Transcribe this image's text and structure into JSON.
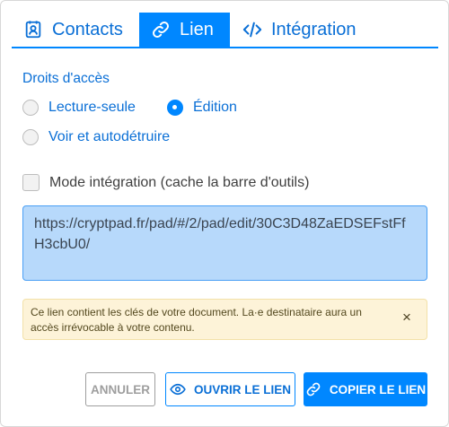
{
  "tabs": [
    {
      "label": "Contacts",
      "icon": "contact-book-icon",
      "active": false
    },
    {
      "label": "Lien",
      "icon": "link-icon",
      "active": true
    },
    {
      "label": "Intégration",
      "icon": "code-icon",
      "active": false
    }
  ],
  "access": {
    "title": "Droits d'accès",
    "options": [
      {
        "label": "Lecture-seule",
        "selected": false
      },
      {
        "label": "Édition",
        "selected": true
      },
      {
        "label": "Voir et autodétruire",
        "selected": false
      }
    ]
  },
  "embed_mode": {
    "label": "Mode intégration (cache la barre d'outils)",
    "checked": false
  },
  "link": {
    "value": "https://cryptpad.fr/pad/#/2/pad/edit/30C3D48ZaEDSEFstFfH3cbU0/"
  },
  "warning": {
    "text": "Ce lien contient les clés de votre document. La·e destinataire aura un accès irrévocable à votre contenu.",
    "close_glyph": "×"
  },
  "buttons": {
    "cancel": "ANNULER",
    "open": "OUVRIR LE LIEN",
    "copy": "COPIER LE LIEN"
  },
  "colors": {
    "accent": "#0087ff",
    "link_box_bg": "#b7d9fb",
    "warning_bg": "#fdf3d8"
  }
}
